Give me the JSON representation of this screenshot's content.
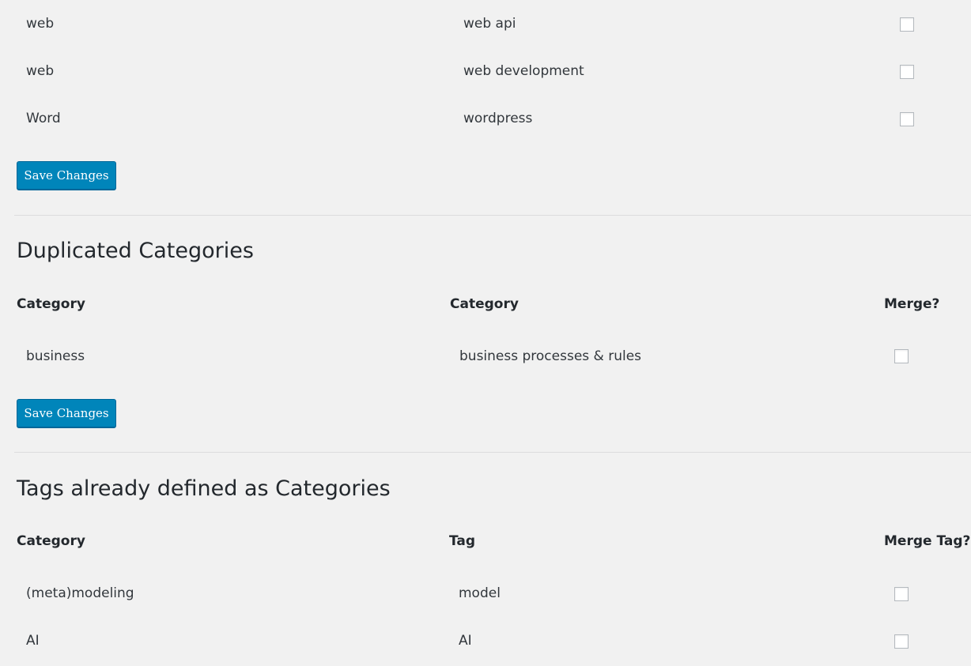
{
  "tag_rows": [
    {
      "left": "web",
      "right": "web api"
    },
    {
      "left": "web",
      "right": "web development"
    },
    {
      "left": "Word",
      "right": "wordpress"
    }
  ],
  "save_label": "Save Changes",
  "duplicated": {
    "title": "Duplicated Categories",
    "col1": "Category",
    "col2": "Category",
    "col3": "Merge?",
    "rows": [
      {
        "left": "business",
        "right": "business processes & rules"
      }
    ]
  },
  "tags_defined": {
    "title": "Tags already defined as Categories",
    "col1": "Category",
    "col2": "Tag",
    "col3": "Merge Tag?",
    "rows": [
      {
        "left": "(meta)modeling",
        "right": "model"
      },
      {
        "left": "AI",
        "right": "AI"
      }
    ]
  }
}
